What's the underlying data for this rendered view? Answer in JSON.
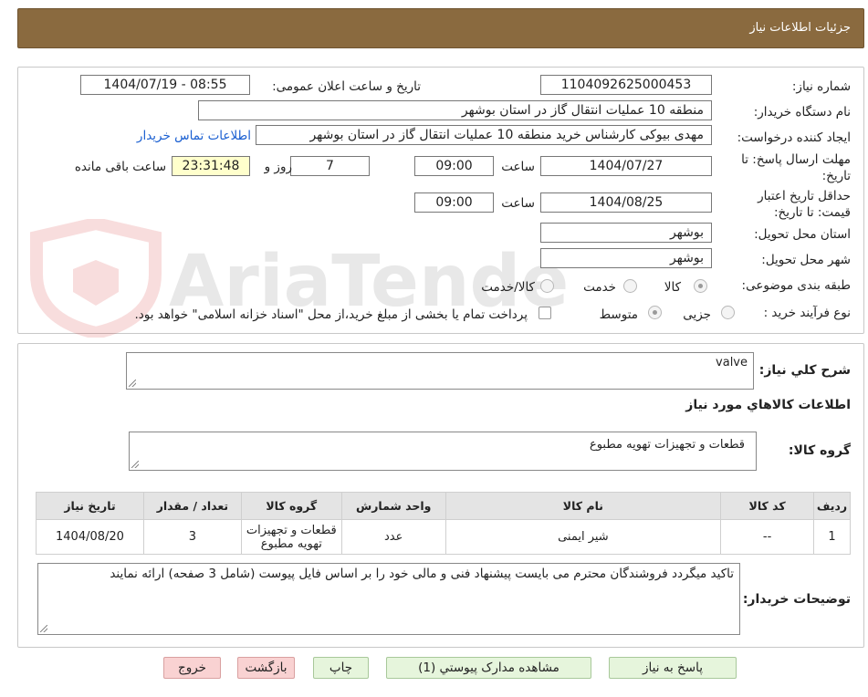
{
  "header": {
    "title": "جزئیات اطلاعات نیاز"
  },
  "watermark": {
    "text": "AriaTender.neT"
  },
  "form": {
    "need_number": {
      "label": "شماره نیاز:",
      "value": "1104092625000453"
    },
    "announce": {
      "label": "تاریخ و ساعت اعلان عمومی:",
      "value": "1404/07/19 - 08:55"
    },
    "buyer_org": {
      "label": "نام دستگاه خریدار:",
      "value": "منطقه 10 عملیات انتقال گاز در استان بوشهر"
    },
    "requester": {
      "label": "ایجاد کننده درخواست:",
      "value": "مهدی بیوکی کارشناس خرید منطقه 10 عملیات انتقال گاز در استان بوشهر",
      "contact_link": "اطلاعات تماس خریدار"
    },
    "deadline": {
      "label_line1": "مهلت ارسال پاسخ: تا",
      "label_line2": "تاریخ:",
      "date": "1404/07/27",
      "time_label": "ساعت",
      "time": "09:00",
      "days": "7",
      "days_label": "روز و",
      "remaining": "23:31:48",
      "remaining_label": "ساعت باقی مانده"
    },
    "validity": {
      "label_line1": "حداقل تاریخ اعتبار",
      "label_line2": "قیمت: تا تاریخ:",
      "date": "1404/08/25",
      "time_label": "ساعت",
      "time": "09:00"
    },
    "province": {
      "label": "استان محل تحویل:",
      "value": "بوشهر"
    },
    "city": {
      "label": "شهر محل تحویل:",
      "value": "بوشهر"
    },
    "category": {
      "label": "طبقه بندی موضوعی:",
      "options": [
        "کالا",
        "خدمت",
        "کالا/خدمت"
      ],
      "selected": "کالا"
    },
    "purchase_type": {
      "label": "نوع فرآیند خرید :",
      "options": [
        "جزیی",
        "متوسط"
      ],
      "selected": "متوسط",
      "payment_note": "پرداخت تمام یا بخشی از مبلغ خرید،از محل \"اسناد خزانه اسلامی\" خواهد بود."
    }
  },
  "description": {
    "label": "شرح کلي نياز:",
    "value": "valve"
  },
  "goods_info": {
    "title": "اطلاعات کالاهاي مورد نياز"
  },
  "goods_group": {
    "label": "گروه کالا:",
    "value": "قطعات و تجهیزات تهویه مطبوع"
  },
  "table": {
    "headers": [
      "رديف",
      "کد کالا",
      "نام کالا",
      "واحد شمارش",
      "گروه کالا",
      "تعداد / مقدار",
      "تاريخ نياز"
    ],
    "rows": [
      [
        "1",
        "--",
        "شیر ایمنی",
        "عدد",
        "قطعات و تجهیزات تهویه مطبوع",
        "3",
        "1404/08/20"
      ]
    ]
  },
  "buyer_notes": {
    "label": "توضیحات خریدار:",
    "value": "تاکید میگردد فروشندگان محترم می بایست پیشنهاد فنی و مالی خود را بر اساس فایل پیوست (شامل 3 صفحه) ارائه نمایند"
  },
  "buttons": {
    "reply": "پاسخ به نیاز",
    "attachments": "مشاهده مدارک پیوستي (1)",
    "print": "چاپ",
    "back": "بازگشت",
    "exit": "خروج"
  }
}
